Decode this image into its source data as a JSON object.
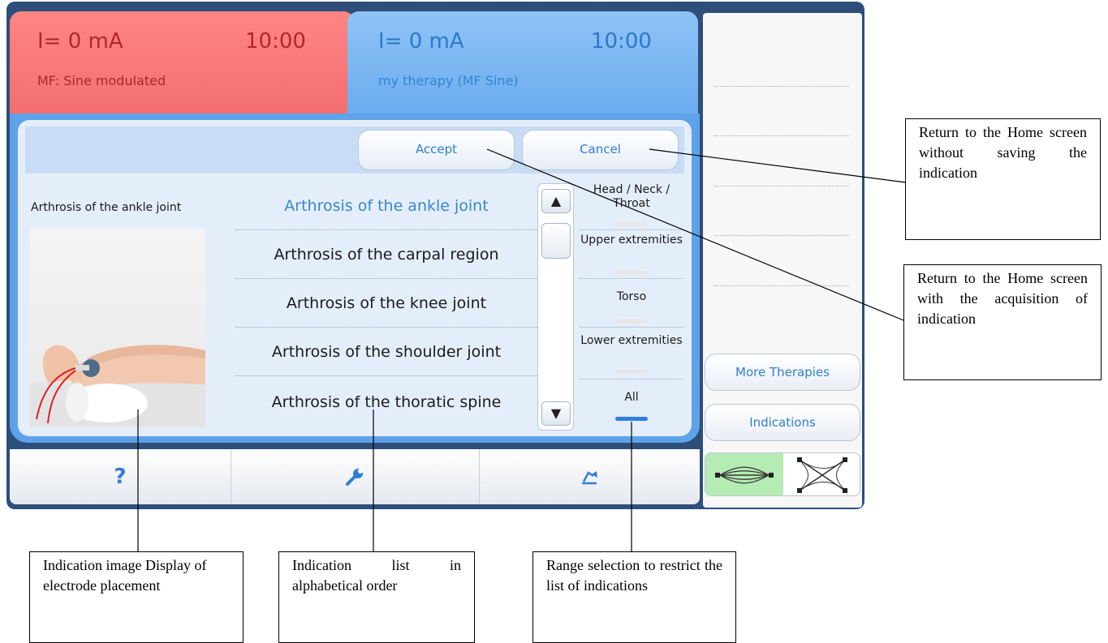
{
  "channel1": {
    "current": "I=  0 mA",
    "time": "10:00",
    "program": "MF: Sine modulated",
    "color": "#f06a6a"
  },
  "channel2": {
    "current": "I=  0 mA",
    "time": "10:00",
    "program": "my therapy (MF Sine)",
    "color": "#64a8ee"
  },
  "actions": {
    "accept": "Accept",
    "cancel": "Cancel"
  },
  "indication_title": "Arthrosis of the ankle joint",
  "indication_image": {
    "alt": "Electrode placement on ankle"
  },
  "indications": [
    {
      "label": "Arthrosis of the ankle joint",
      "selected": true
    },
    {
      "label": "Arthrosis of the carpal region",
      "selected": false
    },
    {
      "label": "Arthrosis of the knee joint",
      "selected": false
    },
    {
      "label": "Arthrosis of the shoulder joint",
      "selected": false
    },
    {
      "label": "Arthrosis of the thoratic spine",
      "selected": false
    }
  ],
  "scroll": {
    "up": "▲",
    "down": "▼"
  },
  "ranges": [
    {
      "label": "Head / Neck / Throat",
      "active": false
    },
    {
      "label": "Upper extremities",
      "active": false
    },
    {
      "label": "Torso",
      "active": false
    },
    {
      "label": "Lower extremities",
      "active": false
    },
    {
      "label": "All",
      "active": true
    }
  ],
  "bottom": {
    "help": "?",
    "settings_icon": "wrench-icon",
    "position_icon": "lamp-icon"
  },
  "right": {
    "more_therapies": "More Therapies",
    "indications": "Indications",
    "mode_parallel_icon": "parallel-electrodes-icon",
    "mode_cross_icon": "crossed-electrodes-icon"
  },
  "accent": "#2f7fd0",
  "callouts": {
    "cancel": "Return to the Home screen without saving the indication",
    "accept": "Return to the Home screen with the acquisition of indication",
    "image": "Indication image Display of electrode placement",
    "list": "Indication list in alphabetical order",
    "range": "Range selection to restrict the list of indications"
  }
}
